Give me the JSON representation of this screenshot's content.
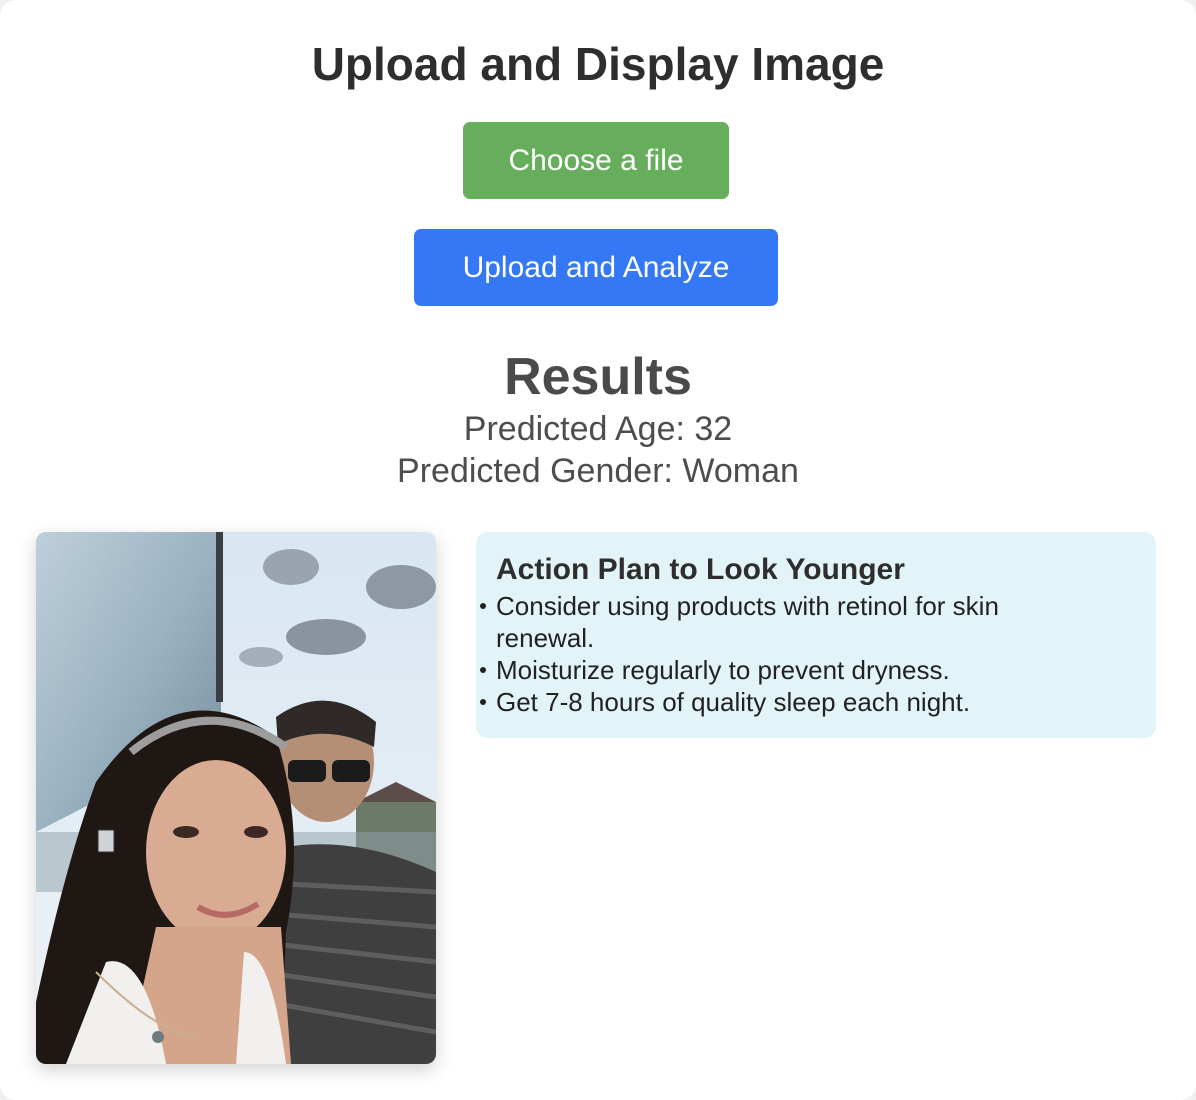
{
  "page": {
    "title": "Upload and Display Image"
  },
  "buttons": {
    "choose_file": "Choose a file",
    "upload_analyze": "Upload and Analyze"
  },
  "results": {
    "title": "Results",
    "age_line": "Predicted Age: 32",
    "gender_line": "Predicted Gender: Woman"
  },
  "action_plan": {
    "title": "Action Plan to Look Younger",
    "items": [
      "Consider using products with retinol for skin renewal.",
      "Moisturize regularly to prevent dryness.",
      "Get 7-8 hours of quality sleep each night."
    ]
  },
  "colors": {
    "choose_button": "#66ae5b",
    "upload_button": "#3478f6",
    "plan_background": "#e3f4f9"
  }
}
